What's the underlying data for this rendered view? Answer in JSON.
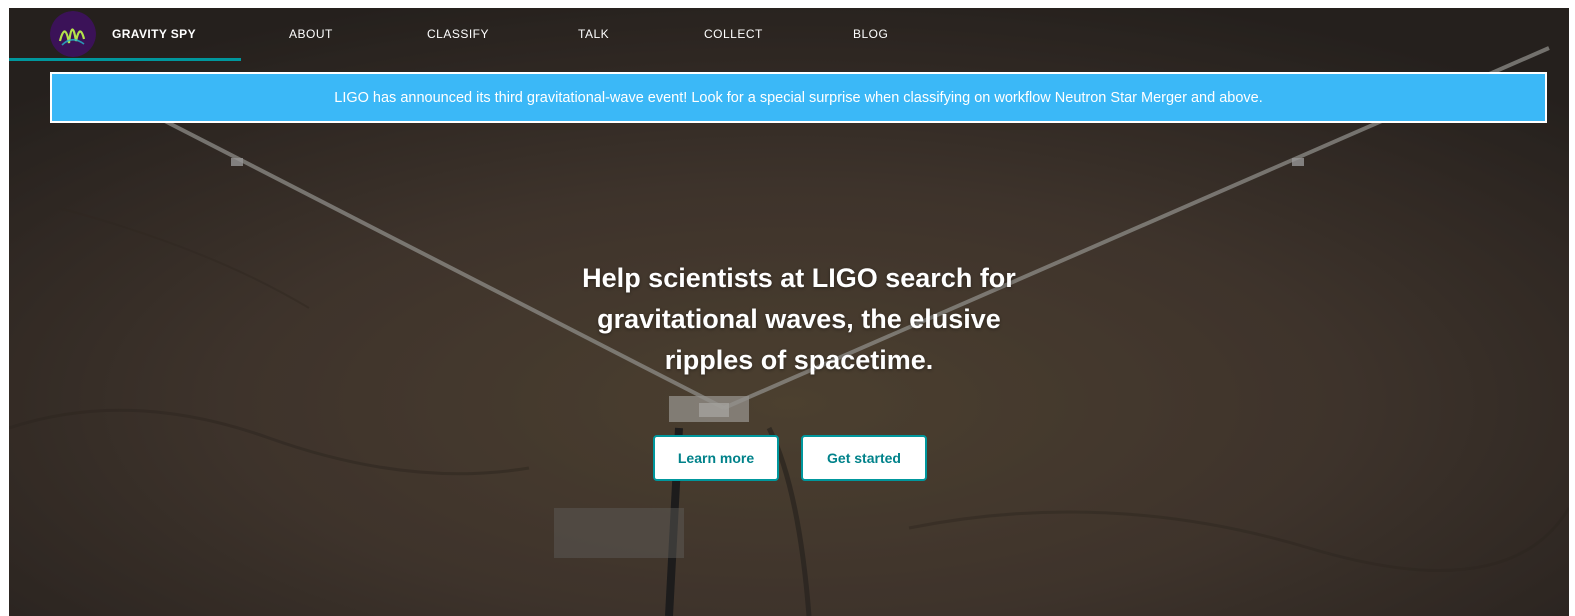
{
  "brand": {
    "name": "GRAVITY SPY",
    "logo_icon": "gravity-spy-logo-icon"
  },
  "nav": {
    "items": [
      {
        "label": "ABOUT"
      },
      {
        "label": "CLASSIFY"
      },
      {
        "label": "TALK"
      },
      {
        "label": "COLLECT"
      },
      {
        "label": "BLOG"
      }
    ]
  },
  "announcement": {
    "text": "LIGO has announced its third gravitational-wave event! Look for a special surprise when classifying on workflow Neutron Star Merger and above."
  },
  "hero": {
    "headline_line1": "Help scientists at LIGO search for",
    "headline_line2": "gravitational waves, the elusive",
    "headline_line3": "ripples of spacetime.",
    "learn_more_label": "Learn more",
    "get_started_label": "Get started"
  },
  "colors": {
    "accent_teal": "#00979d",
    "banner_blue": "#3bb8f7",
    "text_white": "#ffffff"
  }
}
